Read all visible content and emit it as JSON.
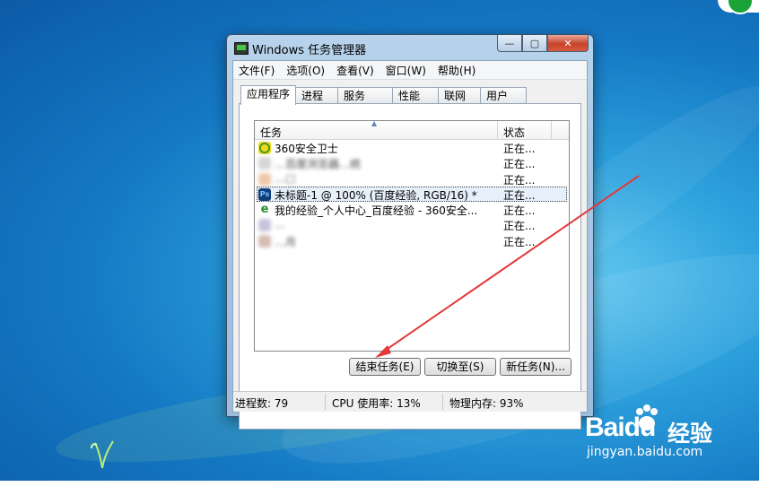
{
  "window": {
    "title": "Windows 任务管理器",
    "controls": {
      "minimize": "—",
      "maximize": "▢",
      "close": "✕"
    }
  },
  "menu": [
    "文件(F)",
    "选项(O)",
    "查看(V)",
    "窗口(W)",
    "帮助(H)"
  ],
  "tabs": [
    "应用程序",
    "进程",
    "服务",
    "性能",
    "联网",
    "用户"
  ],
  "active_tab": "应用程序",
  "list": {
    "columns": {
      "task": "任务",
      "status": "状态"
    },
    "rows": [
      {
        "name": "360安全卫士",
        "status": "正在...",
        "icon": "360-safe-icon"
      },
      {
        "name": "…百度浏览器…统",
        "status": "正在...",
        "icon": "blurred-app-icon",
        "blurred": true
      },
      {
        "name": "…□",
        "status": "正在...",
        "icon": "blurred-app-icon",
        "blurred": true
      },
      {
        "name": "未标题-1 @ 100% (百度经验, RGB/16) *",
        "status": "正在...",
        "icon": "photoshop-icon",
        "selected": true
      },
      {
        "name": "我的经验_个人中心_百度经验 - 360安全...",
        "status": "正在...",
        "icon": "ie-icon"
      },
      {
        "name": "…",
        "status": "正在...",
        "icon": "blurred-app-icon",
        "blurred": true
      },
      {
        "name": "…月",
        "status": "正在...",
        "icon": "blurred-app-icon",
        "blurred": true
      }
    ]
  },
  "buttons": {
    "end_task": "结束任务(E)",
    "switch_to": "切换至(S)",
    "new_task": "新任务(N)..."
  },
  "statusbar": {
    "processes": "进程数: 79",
    "cpu": "CPU 使用率: 13%",
    "memory": "物理内存: 93%"
  },
  "watermark": {
    "brand": "Baidu",
    "cn": "经验",
    "url": "jingyan.baidu.com"
  },
  "colors": {
    "desktop": "#1579c4",
    "arrow": "#e2393a",
    "selection": "#e6f0fb",
    "close": "#c7432a"
  }
}
